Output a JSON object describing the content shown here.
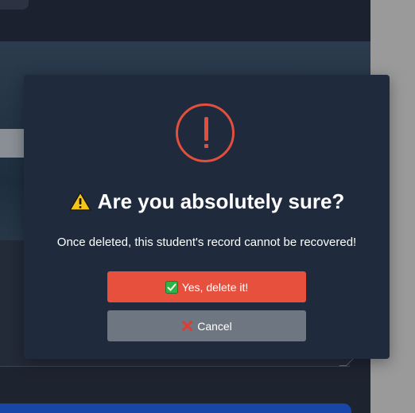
{
  "dialog": {
    "title": "Are you absolutely sure?",
    "title_icon": "warning-sign-icon",
    "status_icon": "exclamation-circle-icon",
    "message": "Once deleted, this student's record cannot be recovered!",
    "confirm_label": "Yes, delete it!",
    "confirm_icon": "check-box-icon",
    "cancel_label": "Cancel",
    "cancel_icon": "cross-mark-icon"
  },
  "colors": {
    "modal_background": "#1f2a3c",
    "danger": "#e8503e",
    "cancel": "#6e7781",
    "warning_yellow": "#f5c518"
  }
}
